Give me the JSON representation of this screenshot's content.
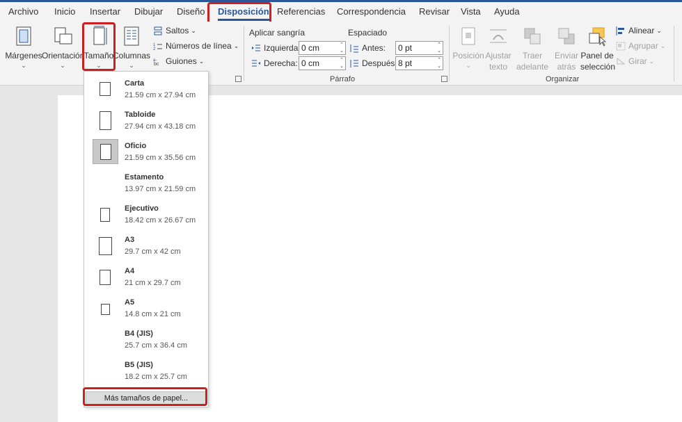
{
  "tabs": [
    "Archivo",
    "Inicio",
    "Insertar",
    "Dibujar",
    "Diseño",
    "Disposición",
    "Referencias",
    "Correspondencia",
    "Revisar",
    "Vista",
    "Ayuda"
  ],
  "active_tab": "Disposición",
  "ribbon": {
    "margenes": "Márgenes",
    "orientacion": "Orientación",
    "tamano": "Tamaño",
    "columnas": "Columnas",
    "saltos": "Saltos",
    "numeros_linea": "Números de línea",
    "guiones": "Guiones",
    "aplicar_sangria": "Aplicar sangría",
    "izquierda_label": "Izquierda:",
    "izquierda_value": "0 cm",
    "derecha_label": "Derecha:",
    "derecha_value": "0 cm",
    "espaciado": "Espaciado",
    "antes_label": "Antes:",
    "antes_value": "0 pt",
    "despues_label": "Después:",
    "despues_value": "8 pt",
    "parrafo_group": "Párrafo",
    "posicion_1": "Posición",
    "ajustar_1": "Ajustar",
    "ajustar_2": "texto",
    "traer_1": "Traer",
    "traer_2": "adelante",
    "enviar_1": "Enviar",
    "enviar_2": "atrás",
    "panel_1": "Panel de",
    "panel_2": "selección",
    "alinear": "Alinear",
    "agrupar": "Agrupar",
    "girar": "Girar",
    "organizar_group": "Organizar"
  },
  "paper_sizes": [
    {
      "name": "Carta",
      "dims": "21.59 cm x 27.94 cm",
      "selected": false
    },
    {
      "name": "Tabloide",
      "dims": "27.94 cm x 43.18 cm",
      "selected": false
    },
    {
      "name": "Oficio",
      "dims": "21.59 cm x 35.56 cm",
      "selected": true
    },
    {
      "name": "Estamento",
      "dims": "13.97 cm x 21.59 cm",
      "selected": false
    },
    {
      "name": "Ejecutivo",
      "dims": "18.42 cm x 26.67 cm",
      "selected": false
    },
    {
      "name": "A3",
      "dims": "29.7 cm x 42 cm",
      "selected": false
    },
    {
      "name": "A4",
      "dims": "21 cm x 29.7 cm",
      "selected": false
    },
    {
      "name": "A5",
      "dims": "14.8 cm x 21 cm",
      "selected": false
    },
    {
      "name": "B4 (JIS)",
      "dims": "25.7 cm x 36.4 cm",
      "selected": false
    },
    {
      "name": "B5 (JIS)",
      "dims": "18.2 cm x 25.7 cm",
      "selected": false
    }
  ],
  "more_sizes": "Más tamaños de papel...",
  "colors": {
    "accent": "#2b579a",
    "highlight": "#cc1f1f"
  }
}
